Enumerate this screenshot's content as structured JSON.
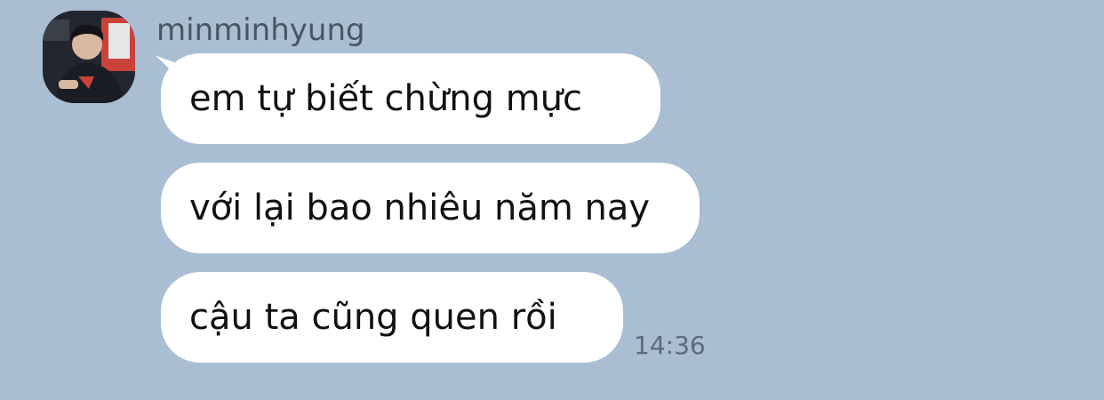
{
  "chat": {
    "sender": {
      "name": "minminhyung",
      "avatar_icon": "user-avatar-photo"
    },
    "messages": [
      {
        "text": "em tự biết chừng mực"
      },
      {
        "text": "với lại bao nhiêu năm nay"
      },
      {
        "text": "cậu ta cũng quen rồi"
      }
    ],
    "last_timestamp": "14:36"
  },
  "colors": {
    "background": "#a9bed3",
    "bubble": "#ffffff",
    "name_text": "#4a5562",
    "timestamp_text": "#5b6b7b"
  }
}
